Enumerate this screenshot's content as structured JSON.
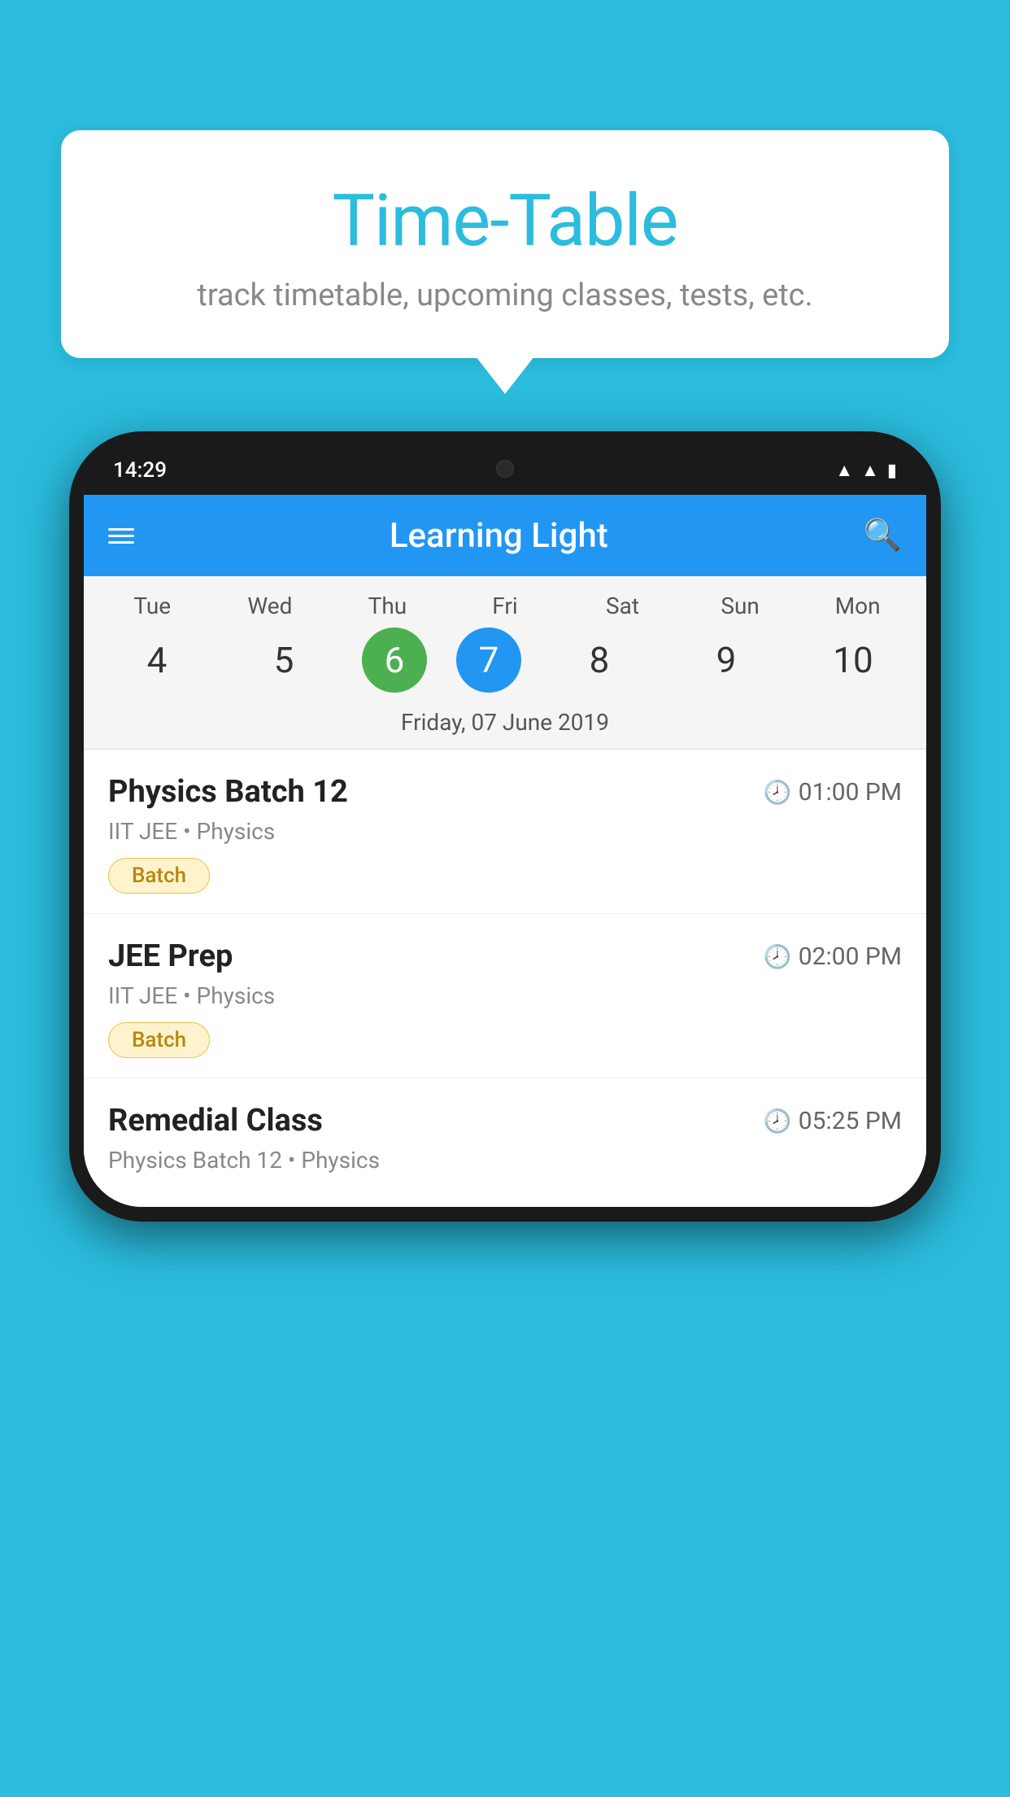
{
  "background_color": "#2BBCDE",
  "bubble": {
    "title": "Time-Table",
    "subtitle": "track timetable, upcoming classes, tests, etc."
  },
  "phone": {
    "status_bar": {
      "time": "14:29"
    },
    "app_bar": {
      "title": "Learning Light"
    },
    "calendar": {
      "days": [
        "Tue",
        "Wed",
        "Thu",
        "Fri",
        "Sat",
        "Sun",
        "Mon"
      ],
      "dates": [
        "4",
        "5",
        "6",
        "7",
        "8",
        "9",
        "10"
      ],
      "today_index": 2,
      "selected_index": 3,
      "date_label": "Friday, 07 June 2019"
    },
    "schedule": [
      {
        "title": "Physics Batch 12",
        "time": "01:00 PM",
        "subtitle": "IIT JEE • Physics",
        "badge": "Batch"
      },
      {
        "title": "JEE Prep",
        "time": "02:00 PM",
        "subtitle": "IIT JEE • Physics",
        "badge": "Batch"
      },
      {
        "title": "Remedial Class",
        "time": "05:25 PM",
        "subtitle": "Physics Batch 12 • Physics",
        "badge": ""
      }
    ]
  }
}
